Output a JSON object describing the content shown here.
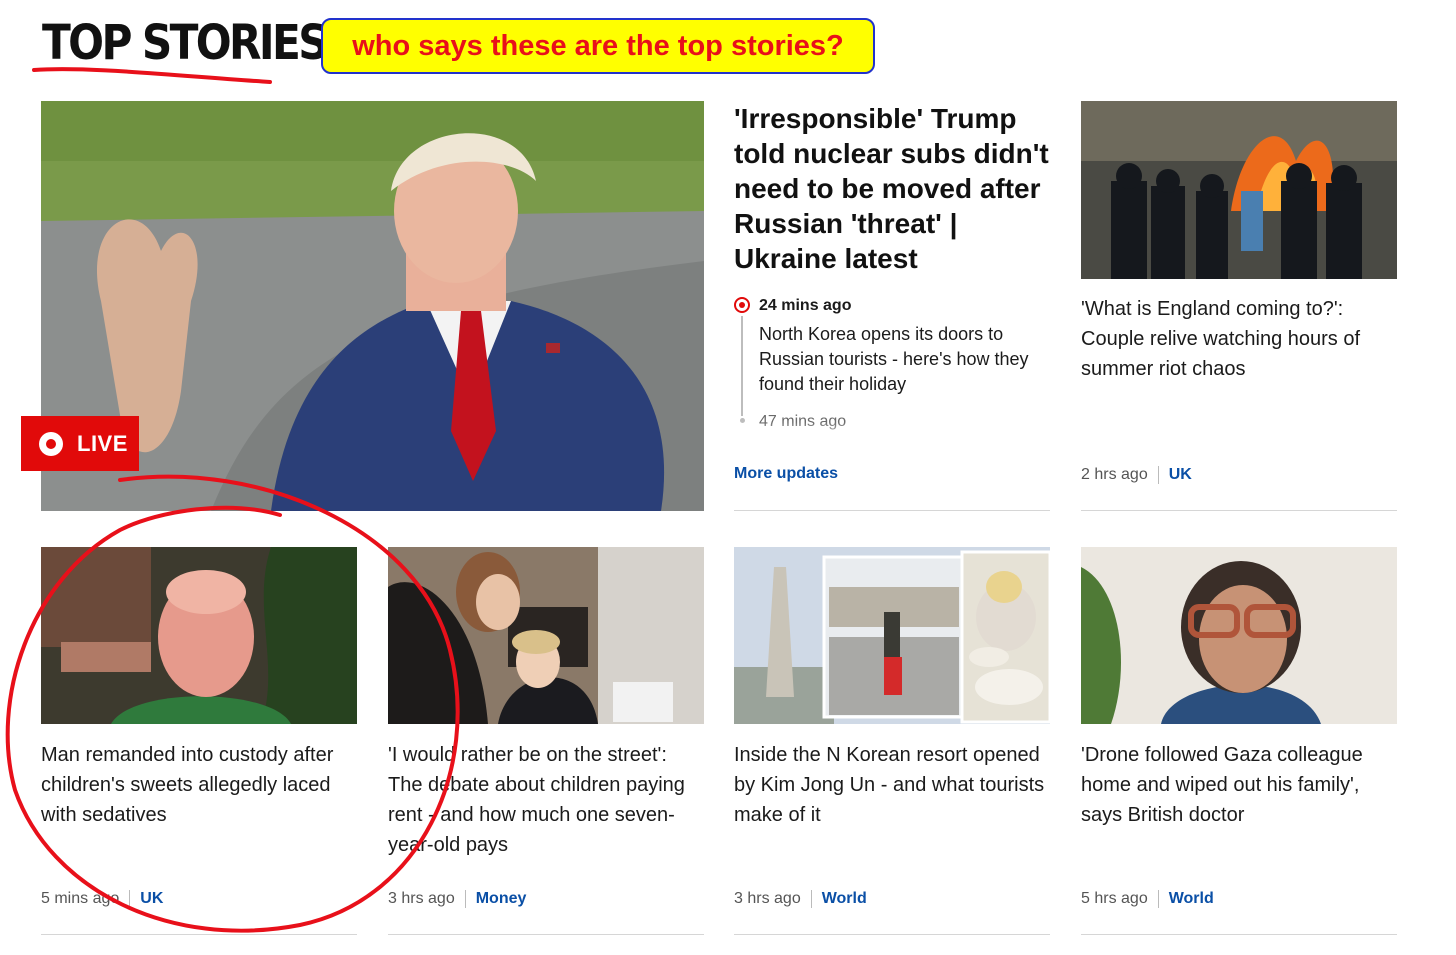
{
  "header": {
    "title": "TOP STORIES"
  },
  "annotation": {
    "text": "who says these are the top stories?"
  },
  "lead": {
    "badge": "LIVE",
    "headline": "'Irresponsible' Trump told nuclear subs didn't need to be moved after Russian 'threat' | Ukraine latest",
    "updates": [
      {
        "time": "24 mins ago",
        "text": "North Korea opens its doors to Russian tourists - here's how they found their holiday"
      },
      {
        "time": "47 mins ago"
      }
    ],
    "more_label": "More updates"
  },
  "side_story": {
    "headline": "'What is England coming to?': Couple relive watching hours of summer riot chaos",
    "time": "2 hrs ago",
    "tag": "UK"
  },
  "stories": [
    {
      "headline": "Man remanded into custody after children's sweets allegedly laced with sedatives",
      "time": "5 mins ago",
      "tag": "UK"
    },
    {
      "headline": "'I would rather be on the street': The debate about children paying rent - and how much one seven-year-old pays",
      "time": "3 hrs ago",
      "tag": "Money"
    },
    {
      "headline": "Inside the N Korean resort opened by Kim Jong Un - and what tourists make of it",
      "time": "3 hrs ago",
      "tag": "World"
    },
    {
      "headline": "'Drone followed Gaza colleague home and wiped out his family', says British doctor",
      "time": "5 hrs ago",
      "tag": "World"
    }
  ],
  "colors": {
    "accent_red": "#e10a0a",
    "link_blue": "#0a4fa6",
    "annotation_bg": "#ffff00",
    "annotation_text": "#e8101a",
    "annotation_border": "#2233cc"
  }
}
